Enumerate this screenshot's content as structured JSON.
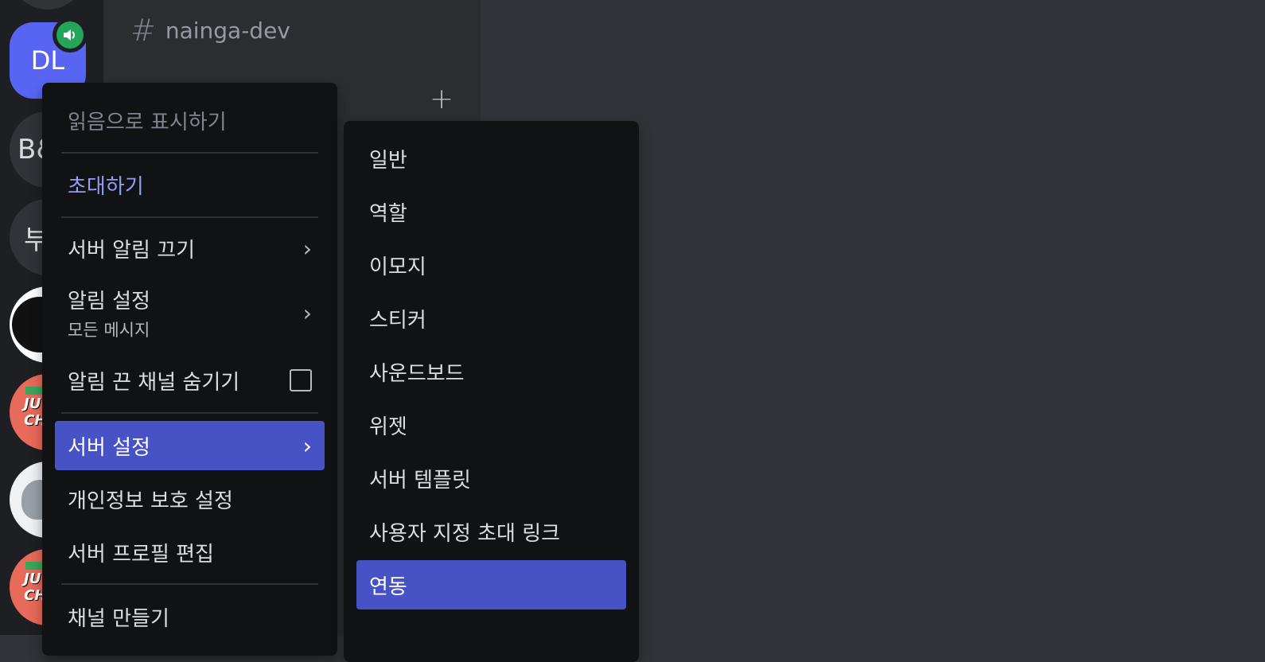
{
  "channel": {
    "hash": "#",
    "name": "nainga-dev"
  },
  "servers": {
    "dl": "DL",
    "b": "B&",
    "bu": "부",
    "jc": "JU\nCHAL"
  },
  "context_menu": {
    "mark_read": "읽음으로 표시하기",
    "invite": "초대하기",
    "mute_server": "서버 알림 끄기",
    "notif_settings": "알림 설정",
    "notif_settings_value": "모든 메시지",
    "hide_muted": "알림 끈 채널 숨기기",
    "server_settings": "서버 설정",
    "privacy_settings": "개인정보 보호 설정",
    "edit_profile": "서버 프로필 편집",
    "create_channel": "채널 만들기"
  },
  "submenu": {
    "items": [
      "일반",
      "역할",
      "이모지",
      "스티커",
      "사운드보드",
      "위젯",
      "서버 템플릿",
      "사용자 지정 초대 링크",
      "연동"
    ],
    "active_index": 8
  },
  "colors": {
    "accent": "#5865f2",
    "menu_active": "#4752c4",
    "voice_green": "#23a55a"
  }
}
